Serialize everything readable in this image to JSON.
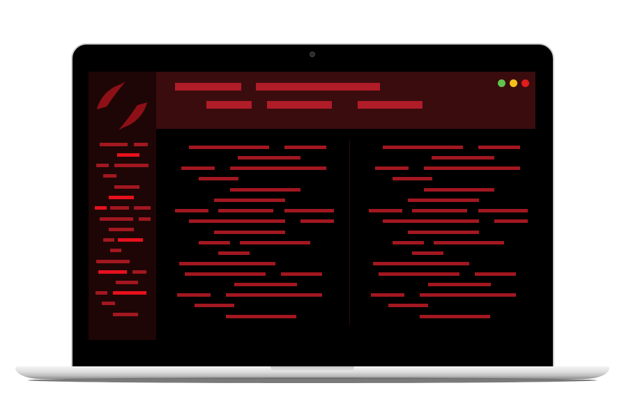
{
  "colors": {
    "sidebar_bg": "#1f0606",
    "header_bg": "#3a0c0e",
    "content_bg": "#000000",
    "line_color": "#a21720",
    "highlight_line_color": "#e8101c",
    "logo_color": "#8e1017"
  },
  "window_controls": [
    {
      "name": "green-dot",
      "color": "#5fc44b"
    },
    {
      "name": "yellow-dot",
      "color": "#f2c21b"
    },
    {
      "name": "red-dot",
      "color": "#e11d1d"
    }
  ],
  "icons": {
    "logo": "swirl-logo-icon",
    "camera": "camera-icon"
  }
}
